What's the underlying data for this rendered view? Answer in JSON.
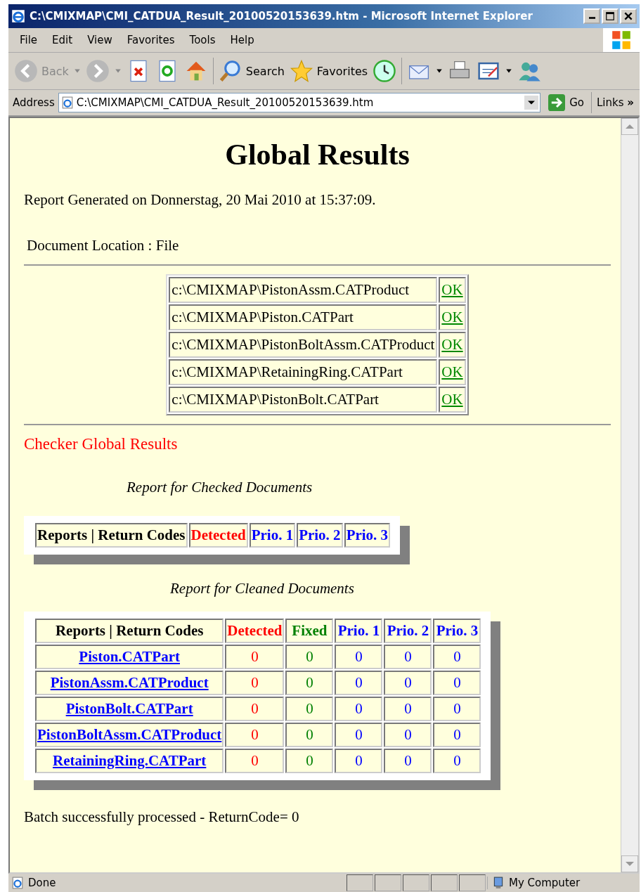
{
  "window": {
    "title": "C:\\CMIXMAP\\CMI_CATDUA_Result_20100520153639.htm - Microsoft Internet Explorer"
  },
  "menu": [
    "File",
    "Edit",
    "View",
    "Favorites",
    "Tools",
    "Help"
  ],
  "toolbar": {
    "back": "Back",
    "search": "Search",
    "favorites": "Favorites"
  },
  "address_bar": {
    "label": "Address",
    "value": "C:\\CMIXMAP\\CMI_CATDUA_Result_20100520153639.htm",
    "go": "Go",
    "links": "Links",
    "links_more": "»"
  },
  "page": {
    "heading": "Global Results",
    "generated": "Report Generated on Donnerstag, 20 Mai 2010 at 15:37:09.",
    "location": "Document Location : File",
    "documents": [
      {
        "path": "c:\\CMIXMAP\\PistonAssm.CATProduct",
        "status": "OK"
      },
      {
        "path": "c:\\CMIXMAP\\Piston.CATPart",
        "status": "OK"
      },
      {
        "path": "c:\\CMIXMAP\\PistonBoltAssm.CATProduct",
        "status": "OK"
      },
      {
        "path": "c:\\CMIXMAP\\RetainingRing.CATPart",
        "status": "OK"
      },
      {
        "path": "c:\\CMIXMAP\\PistonBolt.CATPart",
        "status": "OK"
      }
    ],
    "section_title": "Checker Global Results",
    "checked_report": {
      "caption": "Report for Checked Documents",
      "columns": [
        {
          "label": "Reports | Return Codes",
          "color": "#000000"
        },
        {
          "label": "Detected",
          "color": "#ff0000"
        },
        {
          "label": "Prio. 1",
          "color": "#0000ff"
        },
        {
          "label": "Prio. 2",
          "color": "#0000ff"
        },
        {
          "label": "Prio. 3",
          "color": "#0000ff"
        }
      ]
    },
    "cleaned_report": {
      "caption": "Report for Cleaned Documents",
      "columns": [
        {
          "label": "Reports | Return Codes",
          "color": "#000000"
        },
        {
          "label": "Detected",
          "color": "#ff0000"
        },
        {
          "label": "Fixed",
          "color": "#008000"
        },
        {
          "label": "Prio. 1",
          "color": "#0000ff"
        },
        {
          "label": "Prio. 2",
          "color": "#0000ff"
        },
        {
          "label": "Prio. 3",
          "color": "#0000ff"
        }
      ],
      "rows": [
        {
          "name": "Piston.CATPart",
          "values": [
            "0",
            "0",
            "0",
            "0",
            "0"
          ]
        },
        {
          "name": "PistonAssm.CATProduct",
          "values": [
            "0",
            "0",
            "0",
            "0",
            "0"
          ]
        },
        {
          "name": "PistonBolt.CATPart",
          "values": [
            "0",
            "0",
            "0",
            "0",
            "0"
          ]
        },
        {
          "name": "PistonBoltAssm.CATProduct",
          "values": [
            "0",
            "0",
            "0",
            "0",
            "0"
          ]
        },
        {
          "name": "RetainingRing.CATPart",
          "values": [
            "0",
            "0",
            "0",
            "0",
            "0"
          ]
        }
      ]
    },
    "footer": "Batch successfully processed - ReturnCode= 0"
  },
  "status_bar": {
    "text": "Done",
    "zone": "My Computer"
  }
}
